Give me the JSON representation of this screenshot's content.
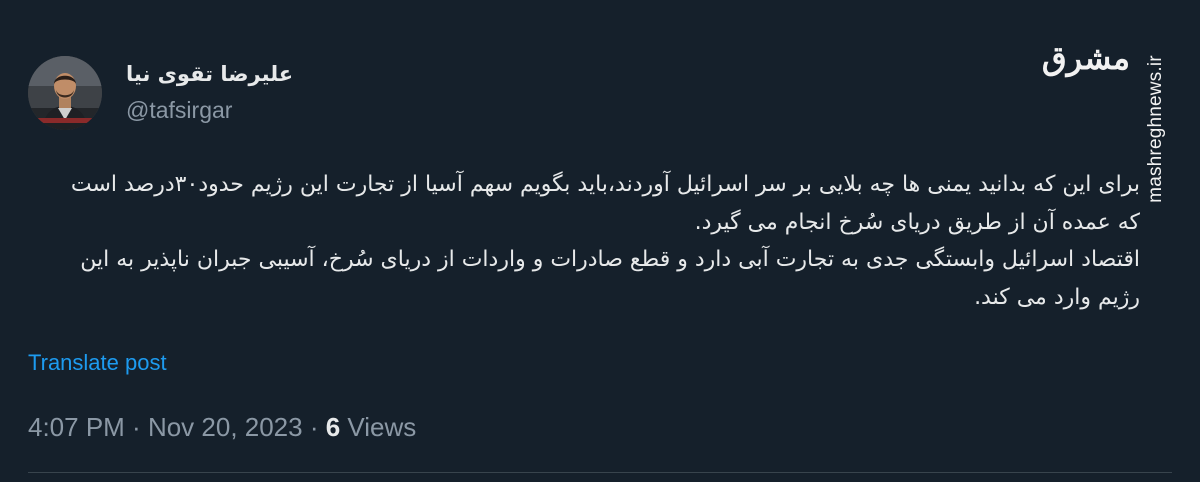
{
  "author": {
    "display_name": "علیرضا تقوی نیا",
    "handle": "@tafsirgar"
  },
  "watermark": {
    "logo_text": "مشرق",
    "url": "mashreghnews.ir"
  },
  "tweet": {
    "paragraphs": [
      "برای این که بدانید یمنی ها چه بلایی بر سر اسرائیل آوردند،باید بگویم سهم آسیا از تجارت این رژیم حدود۳۰درصد است که عمده آن از طریق دریای سُرخ انجام می گیرد.",
      "اقتصاد اسرائیل وابستگی جدی به تجارت آبی دارد و قطع صادرات و واردات از دریای سُرخ، آسیبی جبران ناپذیر به این رژیم وارد می کند."
    ],
    "translate_label": "Translate post",
    "time": "4:07 PM",
    "separator1": " · ",
    "date": "Nov 20, 2023",
    "separator2": " · ",
    "views_count": "6",
    "views_label": " Views"
  },
  "colors": {
    "background": "#15202b",
    "text_primary": "#e7e9ea",
    "text_secondary": "#8b98a5",
    "link": "#1d9bf0"
  }
}
